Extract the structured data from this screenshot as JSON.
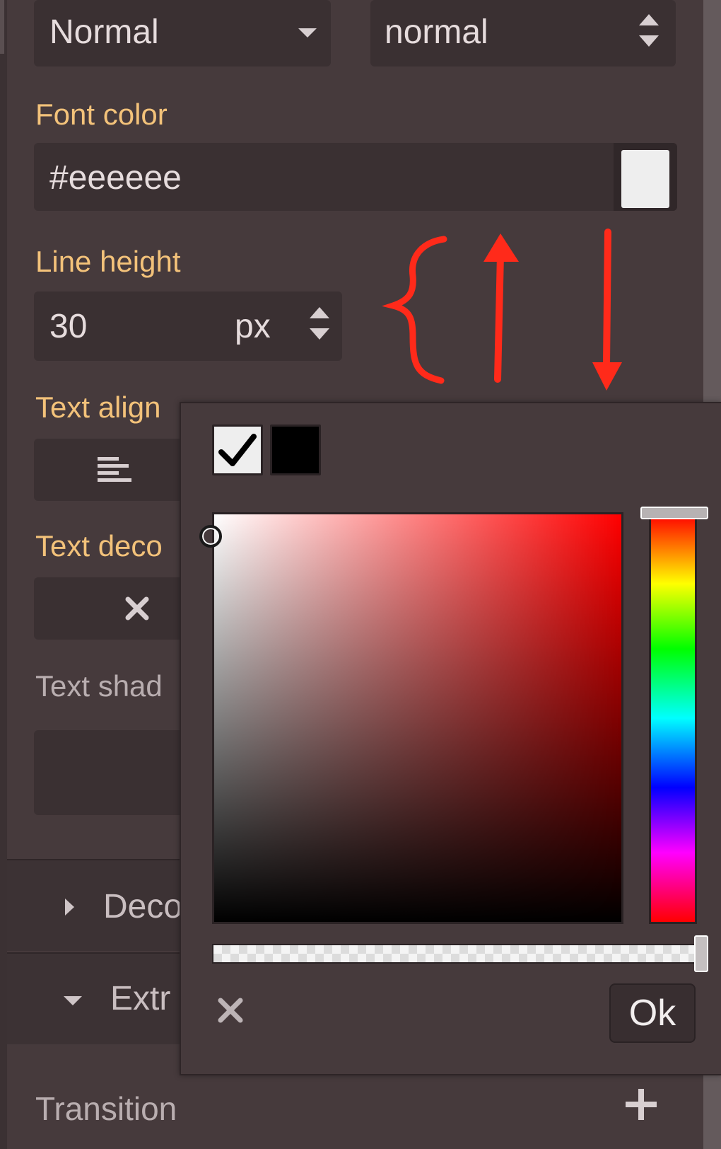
{
  "typography": {
    "font_style_value": "Normal",
    "letter_spacing_value": "normal",
    "font_color_label": "Font color",
    "font_color_value": "#eeeeee",
    "line_height_label": "Line height",
    "line_height_value": "30",
    "line_height_unit": "px",
    "text_align_label": "Text align",
    "text_decoration_label": "Text deco",
    "text_shadow_label": "Text shad"
  },
  "sections": {
    "decorations_label": "Deco",
    "extra_label": "Extr",
    "transition_label": "Transition"
  },
  "color_picker": {
    "ok_label": "Ok",
    "current_color": "#eeeeee",
    "presets": [
      "#eeeeee",
      "#000000"
    ],
    "hue_color": "#ff0000"
  },
  "colors": {
    "label_accent": "#f3c27a",
    "panel_bg": "#463a3c",
    "annotation_red": "#ff2a1a"
  }
}
